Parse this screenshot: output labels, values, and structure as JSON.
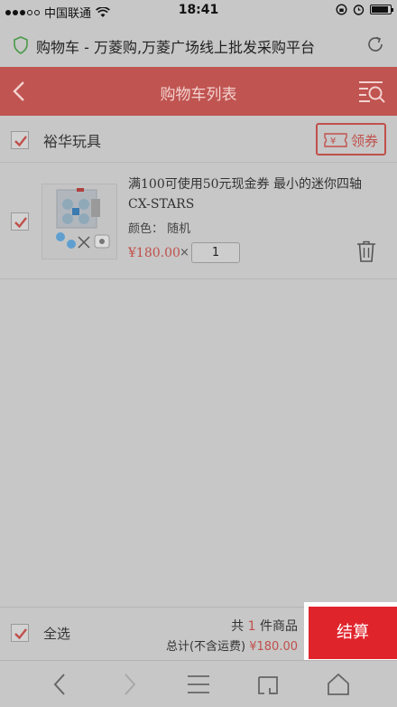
{
  "status_bar": {
    "carrier": "中国联通",
    "time": "18:41"
  },
  "browser": {
    "page_title": "购物车 - 万菱购,万菱广场线上批发采购平台"
  },
  "header": {
    "title": "购物车列表"
  },
  "shop": {
    "name": "裕华玩具",
    "coupon_label": "领券",
    "coupon_icon_text": "¥"
  },
  "item": {
    "name": "满100可使用50元现金券 最小的迷你四轴CX-STARS",
    "attr_label": "颜色",
    "attr_value": "随机",
    "price": "¥180.00",
    "times": "×",
    "quantity": "1"
  },
  "footer": {
    "select_all": "全选",
    "count_prefix": "共",
    "count": "1",
    "count_suffix": "件商品",
    "total_label": "总计(不含运费)",
    "total": "¥180.00",
    "checkout": "结算"
  },
  "colors": {
    "accent": "#c0504b",
    "checkout_bg": "#e0242c",
    "overlay_gray": "#c7c7c7"
  },
  "icons": {
    "back": "chevron-left-icon",
    "search_list": "search-list-icon",
    "coupon": "ticket-icon",
    "delete": "trash-icon",
    "secure": "shield-icon",
    "reload": "reload-icon"
  }
}
